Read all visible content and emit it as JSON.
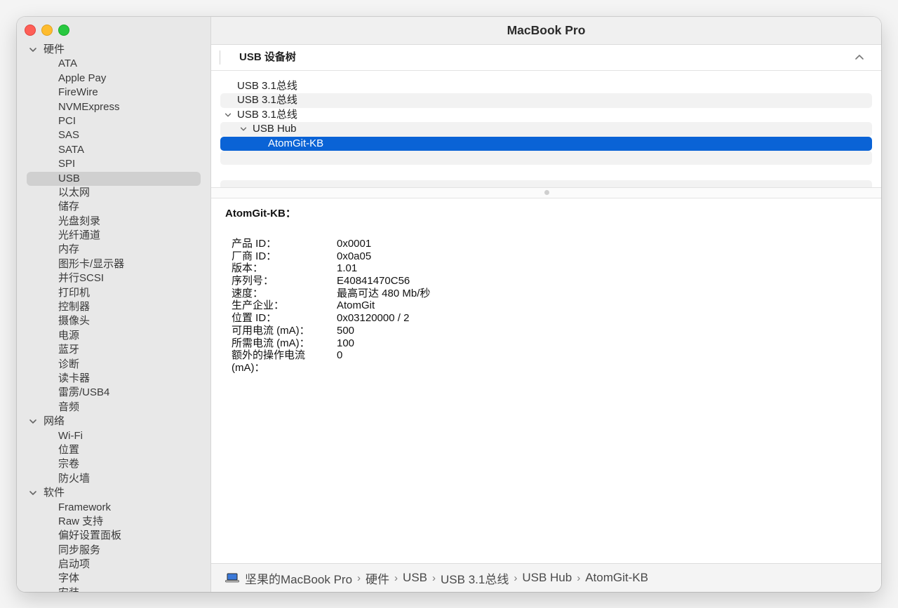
{
  "window": {
    "title": "MacBook Pro"
  },
  "sidebar": {
    "groups": [
      {
        "label": "硬件",
        "items": [
          "ATA",
          "Apple Pay",
          "FireWire",
          "NVMExpress",
          "PCI",
          "SAS",
          "SATA",
          "SPI",
          "USB",
          "以太网",
          "储存",
          "光盘刻录",
          "光纤通道",
          "内存",
          "图形卡/显示器",
          "并行SCSI",
          "打印机",
          "控制器",
          "摄像头",
          "电源",
          "蓝牙",
          "诊断",
          "读卡器",
          "雷雳/USB4",
          "音频"
        ]
      },
      {
        "label": "网络",
        "items": [
          "Wi-Fi",
          "位置",
          "宗卷",
          "防火墙"
        ]
      },
      {
        "label": "软件",
        "items": [
          "Framework",
          "Raw 支持",
          "偏好设置面板",
          "同步服务",
          "启动项",
          "字体",
          "安装"
        ]
      }
    ],
    "selected": "USB"
  },
  "section": {
    "title": "USB 设备树"
  },
  "device_tree": [
    {
      "label": "USB 3.1总线",
      "level": 0,
      "expanded": false
    },
    {
      "label": "USB 3.1总线",
      "level": 0,
      "expanded": false
    },
    {
      "label": "USB 3.1总线",
      "level": 0,
      "expanded": true
    },
    {
      "label": "USB Hub",
      "level": 1,
      "expanded": true
    },
    {
      "label": "AtomGit-KB",
      "level": 2,
      "selected": true
    }
  ],
  "detail": {
    "title": "AtomGit-KB：",
    "rows": [
      {
        "k": "产品 ID：",
        "v": "0x0001"
      },
      {
        "k": "厂商 ID：",
        "v": "0x0a05"
      },
      {
        "k": "版本：",
        "v": "1.01"
      },
      {
        "k": "序列号：",
        "v": "E40841470C56"
      },
      {
        "k": "速度：",
        "v": "最高可达 480 Mb/秒"
      },
      {
        "k": "生产企业：",
        "v": "AtomGit"
      },
      {
        "k": "位置 ID：",
        "v": "0x03120000 / 2"
      },
      {
        "k": "可用电流 (mA)：",
        "v": "500"
      },
      {
        "k": "所需电流 (mA)：",
        "v": "100"
      },
      {
        "k": "额外的操作电流 (mA)：",
        "v": "0"
      }
    ]
  },
  "breadcrumb": [
    "坚果的MacBook Pro",
    "硬件",
    "USB",
    "USB 3.1总线",
    "USB Hub",
    "AtomGit-KB"
  ],
  "colors": {
    "selection": "#0a63d6",
    "sidebar_selection": "#d0d0d0"
  }
}
